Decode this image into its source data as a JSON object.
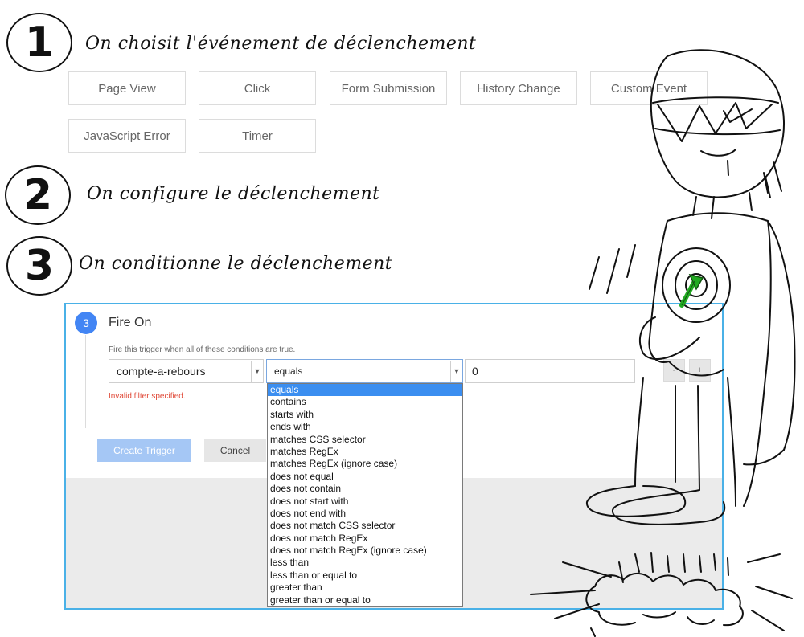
{
  "steps": [
    {
      "number": "1",
      "title": "On choisit l'événement de déclenchement"
    },
    {
      "number": "2",
      "title": "On configure le déclenchement"
    },
    {
      "number": "3",
      "title": "On conditionne le déclenchement"
    }
  ],
  "trigger_types": [
    "Page View",
    "Click",
    "Form Submission",
    "History Change",
    "Custom Event",
    "JavaScript Error",
    "Timer"
  ],
  "panel": {
    "step_number": "3",
    "title": "Fire On",
    "hint": "Fire this trigger when all of these conditions are true.",
    "variable_value": "compte-a-rebours",
    "operator_value": "equals",
    "value_input": "0",
    "minus_label": "-",
    "plus_label": "+",
    "error": "Invalid filter specified.",
    "create_label": "Create Trigger",
    "cancel_label": "Cancel"
  },
  "operator_options": [
    "equals",
    "contains",
    "starts with",
    "ends with",
    "matches CSS selector",
    "matches RegEx",
    "matches RegEx (ignore case)",
    "does not equal",
    "does not contain",
    "does not start with",
    "does not end with",
    "does not match CSS selector",
    "does not match RegEx",
    "does not match RegEx (ignore case)",
    "less than",
    "less than or equal to",
    "greater than",
    "greater than or equal to"
  ],
  "selected_operator_index": 0,
  "colors": {
    "accent": "#4285f4",
    "panel_border": "#4ab1e7",
    "error": "#e04a39",
    "selection": "#3b8ef0",
    "target_marker": "#22aa22"
  }
}
